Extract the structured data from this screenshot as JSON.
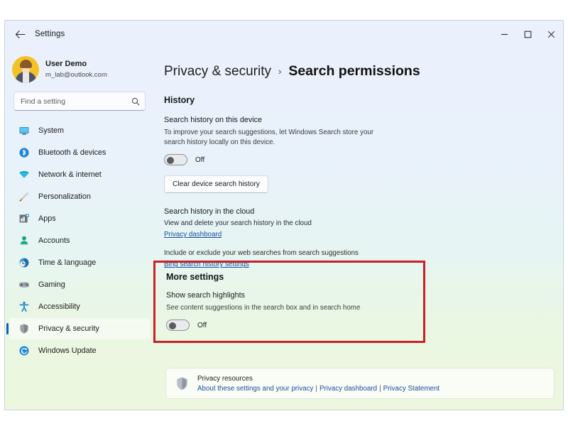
{
  "window": {
    "app_title": "Settings",
    "back_icon": "back-arrow-icon",
    "controls": {
      "minimize": "minimize-icon",
      "maximize": "maximize-icon",
      "close": "close-icon"
    }
  },
  "sidebar": {
    "account": {
      "name": "User Demo",
      "email": "m_lab@outlook.com",
      "avatar_icon": "user-avatar"
    },
    "search": {
      "placeholder": "Find a setting",
      "value": "",
      "icon": "search-icon"
    },
    "items": [
      {
        "label": "System",
        "icon": "monitor-icon",
        "selected": false
      },
      {
        "label": "Bluetooth & devices",
        "icon": "bluetooth-icon",
        "selected": false
      },
      {
        "label": "Network & internet",
        "icon": "wifi-icon",
        "selected": false
      },
      {
        "label": "Personalization",
        "icon": "paintbrush-icon",
        "selected": false
      },
      {
        "label": "Apps",
        "icon": "apps-icon",
        "selected": false
      },
      {
        "label": "Accounts",
        "icon": "person-icon",
        "selected": false
      },
      {
        "label": "Time & language",
        "icon": "clock-icon",
        "selected": false
      },
      {
        "label": "Gaming",
        "icon": "gamepad-icon",
        "selected": false
      },
      {
        "label": "Accessibility",
        "icon": "accessibility-icon",
        "selected": false
      },
      {
        "label": "Privacy & security",
        "icon": "shield-icon",
        "selected": true
      },
      {
        "label": "Windows Update",
        "icon": "update-icon",
        "selected": false
      }
    ]
  },
  "breadcrumb": {
    "parent": "Privacy & security",
    "separator": "›",
    "current": "Search permissions"
  },
  "history": {
    "title": "History",
    "device": {
      "heading": "Search history on this device",
      "description": "To improve your search suggestions, let Windows Search store your search history locally on this device.",
      "toggle_state": "Off",
      "clear_button": "Clear device search history"
    },
    "cloud": {
      "heading": "Search history in the cloud",
      "line1": "View and delete your search history in the cloud",
      "link1": "Privacy dashboard",
      "line2": "Include or exclude your web searches from search suggestions",
      "link2": "Bing search history settings"
    }
  },
  "more_settings": {
    "title": "More settings",
    "highlight_color": "#cc2027",
    "highlighted": true,
    "search_highlights": {
      "heading": "Show search highlights",
      "description": "See content suggestions in the search box and in search home",
      "toggle_state": "Off"
    }
  },
  "privacy_resources": {
    "icon": "shield-icon",
    "title": "Privacy resources",
    "links": [
      "About these settings and your privacy",
      "Privacy dashboard",
      "Privacy Statement"
    ],
    "separator": "|"
  }
}
